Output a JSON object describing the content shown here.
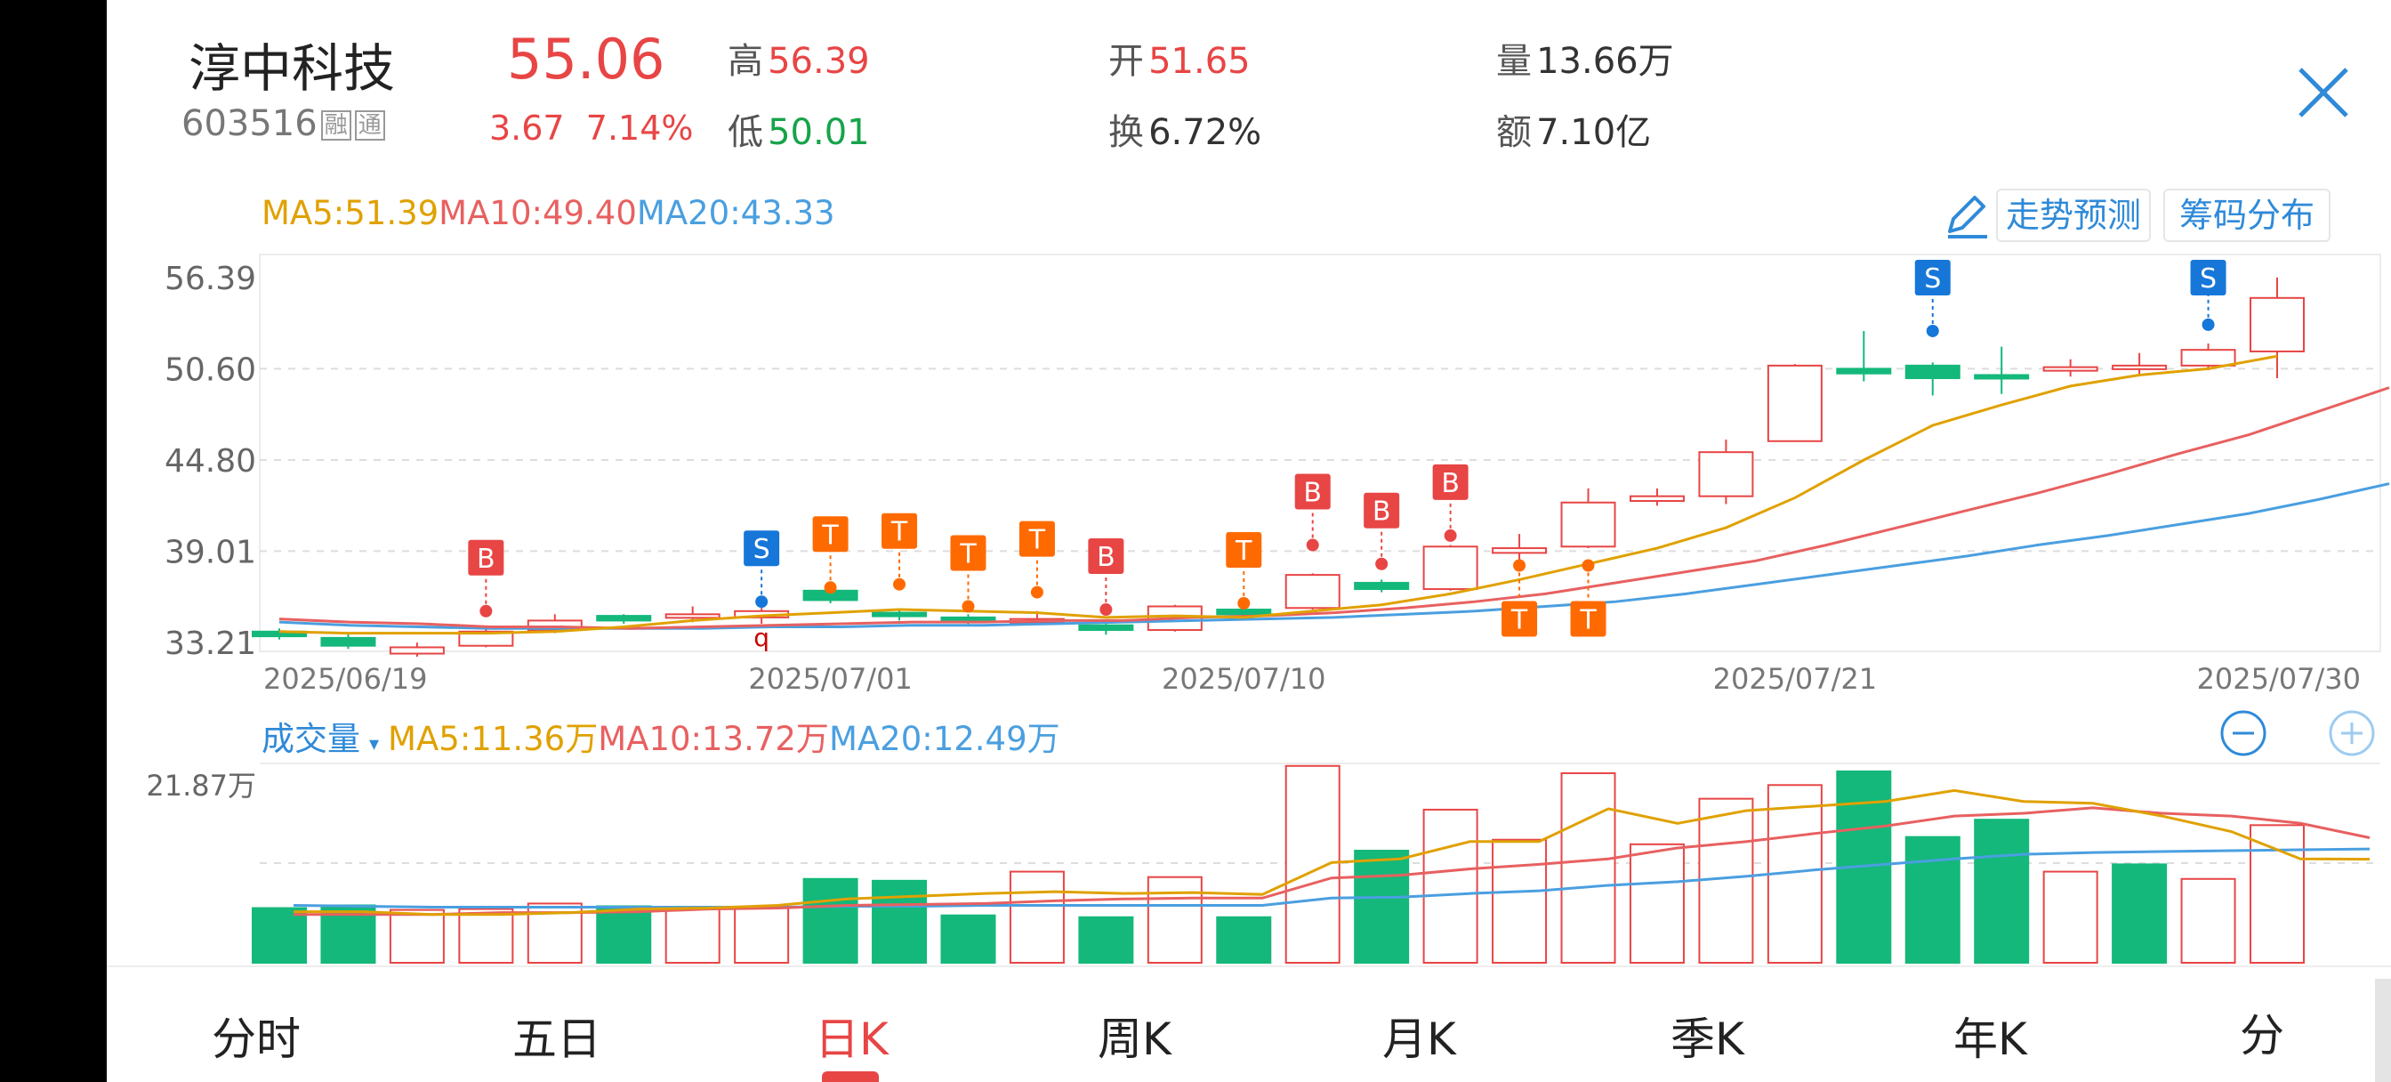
{
  "header": {
    "stock_name": "淳中科技",
    "stock_code": "603516",
    "tags": [
      "融",
      "通"
    ],
    "price": "55.06",
    "change": "3.67",
    "change_pct": "7.14%",
    "high_label": "高",
    "high": "56.39",
    "low_label": "低",
    "low": "50.01",
    "open_label": "开",
    "open": "51.65",
    "turnover_label": "换",
    "turnover": "6.72%",
    "volume_label": "量",
    "volume": "13.66万",
    "amount_label": "额",
    "amount": "7.10亿",
    "close_icon": "close-icon"
  },
  "ma": {
    "ma5": "MA5:51.39",
    "ma10": "MA10:49.40",
    "ma20": "MA20:43.33"
  },
  "buttons": {
    "trend": "走势预测",
    "chips": "筹码分布",
    "edit_icon": "pencil-icon"
  },
  "colors": {
    "up": "#e84545",
    "down": "#14b87a",
    "ma5": "#e0a100",
    "ma10": "#e86060",
    "ma20": "#4a9fe0",
    "accent": "#2f8ad8",
    "signal_t": "#ff6a00",
    "signal_s": "#1677d9"
  },
  "price_axis": {
    "labels": [
      "56.39",
      "50.60",
      "44.80",
      "39.01",
      "33.21"
    ],
    "values": [
      56.39,
      50.6,
      44.8,
      39.01,
      33.21
    ]
  },
  "date_axis": [
    "2025/06/19",
    "2025/07/01",
    "2025/07/10",
    "2025/07/21",
    "2025/07/30"
  ],
  "volume_panel": {
    "title": "成交量",
    "ma5": "MA5:11.36万",
    "ma10": "MA10:13.72万",
    "ma20": "MA20:12.49万",
    "max_label": "21.87万",
    "max_value": 21.87,
    "zoom_out_icon": "minus-circle-icon",
    "zoom_in_icon": "plus-circle-icon"
  },
  "chart_data": {
    "type": "candlestick",
    "ylim": [
      33.21,
      56.39
    ],
    "candles": [
      {
        "o": 33.9,
        "c": 33.6,
        "h": 34.1,
        "l": 33.4
      },
      {
        "o": 33.5,
        "c": 33.0,
        "h": 33.8,
        "l": 32.8
      },
      {
        "o": 32.5,
        "c": 32.9,
        "h": 33.2,
        "l": 32.3
      },
      {
        "o": 33.0,
        "c": 33.9,
        "h": 34.2,
        "l": 32.9
      },
      {
        "o": 34.0,
        "c": 34.6,
        "h": 35.0,
        "l": 33.8
      },
      {
        "o": 34.9,
        "c": 34.6,
        "h": 35.0,
        "l": 34.4
      },
      {
        "o": 34.9,
        "c": 35.0,
        "h": 35.5,
        "l": 34.5
      },
      {
        "o": 34.8,
        "c": 35.2,
        "h": 35.4,
        "l": 34.4
      },
      {
        "o": 36.5,
        "c": 35.9,
        "h": 36.6,
        "l": 35.7
      },
      {
        "o": 35.1,
        "c": 34.9,
        "h": 35.3,
        "l": 34.6
      },
      {
        "o": 34.8,
        "c": 34.5,
        "h": 35.0,
        "l": 34.3
      },
      {
        "o": 34.6,
        "c": 34.7,
        "h": 35.2,
        "l": 34.4
      },
      {
        "o": 34.3,
        "c": 34.0,
        "h": 34.5,
        "l": 33.7
      },
      {
        "o": 34.0,
        "c": 35.5,
        "h": 35.6,
        "l": 33.9
      },
      {
        "o": 35.3,
        "c": 35.0,
        "h": 35.4,
        "l": 34.8
      },
      {
        "o": 35.4,
        "c": 37.5,
        "h": 37.6,
        "l": 35.3
      },
      {
        "o": 37.0,
        "c": 36.6,
        "h": 37.2,
        "l": 36.4
      },
      {
        "o": 36.6,
        "c": 39.3,
        "h": 39.4,
        "l": 36.5
      },
      {
        "o": 38.9,
        "c": 39.2,
        "h": 40.1,
        "l": 38.1
      },
      {
        "o": 39.3,
        "c": 42.1,
        "h": 43.0,
        "l": 39.2
      },
      {
        "o": 42.2,
        "c": 42.5,
        "h": 43.0,
        "l": 41.9
      },
      {
        "o": 42.5,
        "c": 45.3,
        "h": 46.1,
        "l": 42.0
      },
      {
        "o": 46.0,
        "c": 50.8,
        "h": 50.9,
        "l": 46.0
      },
      {
        "o": 50.6,
        "c": 50.3,
        "h": 53.0,
        "l": 49.8
      },
      {
        "o": 50.8,
        "c": 50.0,
        "h": 51.0,
        "l": 48.9
      },
      {
        "o": 50.2,
        "c": 50.1,
        "h": 52.0,
        "l": 49.0
      },
      {
        "o": 50.5,
        "c": 50.7,
        "h": 51.2,
        "l": 50.1
      },
      {
        "o": 50.6,
        "c": 50.8,
        "h": 51.6,
        "l": 50.2
      },
      {
        "o": 50.8,
        "c": 51.8,
        "h": 52.2,
        "l": 50.5
      },
      {
        "o": 51.7,
        "c": 55.1,
        "h": 56.4,
        "l": 50.0
      }
    ],
    "ma5_series": [
      33.9,
      33.8,
      33.8,
      33.8,
      33.9,
      34.2,
      34.6,
      34.9,
      35.1,
      35.3,
      35.2,
      35.1,
      34.8,
      34.9,
      34.8,
      35.2,
      35.6,
      36.3,
      37.2,
      38.2,
      39.2,
      40.5,
      42.4,
      44.8,
      47.0,
      48.3,
      49.5,
      50.2,
      50.6,
      51.4
    ],
    "ma10_series": [
      34.7,
      34.5,
      34.4,
      34.2,
      34.2,
      34.1,
      34.2,
      34.3,
      34.4,
      34.5,
      34.5,
      34.6,
      34.6,
      34.8,
      34.9,
      35.1,
      35.4,
      35.8,
      36.3,
      37.0,
      37.7,
      38.4,
      39.4,
      40.5,
      41.6,
      42.7,
      43.9,
      45.2,
      46.4,
      47.9,
      49.4
    ],
    "ma20_series": [
      34.5,
      34.3,
      34.2,
      34.1,
      34.1,
      34.1,
      34.1,
      34.2,
      34.2,
      34.3,
      34.3,
      34.4,
      34.5,
      34.6,
      34.7,
      34.8,
      35.0,
      35.2,
      35.5,
      35.8,
      36.3,
      36.9,
      37.5,
      38.1,
      38.7,
      39.4,
      40.0,
      40.7,
      41.4,
      42.3,
      43.3
    ],
    "signals": [
      {
        "i": 3,
        "label": "B",
        "type": "buy",
        "pos": "above",
        "price": 35.2
      },
      {
        "i": 7,
        "label": "S",
        "type": "sell",
        "pos": "above",
        "price": 35.8
      },
      {
        "i": 8,
        "label": "T",
        "type": "t",
        "pos": "above",
        "price": 36.7
      },
      {
        "i": 9,
        "label": "T",
        "type": "t",
        "pos": "above",
        "price": 36.9
      },
      {
        "i": 10,
        "label": "T",
        "type": "t",
        "pos": "above",
        "price": 35.5
      },
      {
        "i": 11,
        "label": "T",
        "type": "t",
        "pos": "above",
        "price": 36.4
      },
      {
        "i": 12,
        "label": "B",
        "type": "buy",
        "pos": "above",
        "price": 35.3
      },
      {
        "i": 14,
        "label": "T",
        "type": "t",
        "pos": "above",
        "price": 35.7
      },
      {
        "i": 15,
        "label": "B",
        "type": "buy",
        "pos": "above",
        "price": 39.4
      },
      {
        "i": 16,
        "label": "B",
        "type": "buy",
        "pos": "above",
        "price": 38.2
      },
      {
        "i": 17,
        "label": "B",
        "type": "buy",
        "pos": "above",
        "price": 40.0
      },
      {
        "i": 18,
        "label": "T",
        "type": "t",
        "pos": "below",
        "price": 38.1
      },
      {
        "i": 19,
        "label": "T",
        "type": "t",
        "pos": "below",
        "price": 38.1
      },
      {
        "i": 24,
        "label": "S",
        "type": "sell",
        "pos": "above",
        "price": 53.0
      },
      {
        "i": 28,
        "label": "S",
        "type": "sell",
        "pos": "above",
        "price": 53.4
      }
    ],
    "annotation": {
      "i": 7,
      "text": "q"
    },
    "volume": [
      {
        "v": 6.0,
        "up": false
      },
      {
        "v": 6.3,
        "up": false
      },
      {
        "v": 5.8,
        "up": true
      },
      {
        "v": 5.9,
        "up": true
      },
      {
        "v": 6.5,
        "up": true
      },
      {
        "v": 6.2,
        "up": false
      },
      {
        "v": 6.1,
        "up": true
      },
      {
        "v": 6.0,
        "up": true
      },
      {
        "v": 9.2,
        "up": false
      },
      {
        "v": 9.0,
        "up": false
      },
      {
        "v": 5.2,
        "up": false
      },
      {
        "v": 10.0,
        "up": true
      },
      {
        "v": 5.0,
        "up": false
      },
      {
        "v": 9.4,
        "up": true
      },
      {
        "v": 5.0,
        "up": false
      },
      {
        "v": 21.6,
        "up": true
      },
      {
        "v": 12.3,
        "up": false
      },
      {
        "v": 16.8,
        "up": true
      },
      {
        "v": 13.5,
        "up": true
      },
      {
        "v": 20.8,
        "up": true
      },
      {
        "v": 13.0,
        "up": true
      },
      {
        "v": 18.0,
        "up": true
      },
      {
        "v": 19.5,
        "up": true
      },
      {
        "v": 21.0,
        "up": false
      },
      {
        "v": 13.8,
        "up": false
      },
      {
        "v": 15.7,
        "up": false
      },
      {
        "v": 10.0,
        "up": true
      },
      {
        "v": 10.8,
        "up": false
      },
      {
        "v": 9.2,
        "up": true
      },
      {
        "v": 15.1,
        "up": true
      }
    ],
    "vol_ma5": [
      5.6,
      5.6,
      5.3,
      5.3,
      5.5,
      5.9,
      6.0,
      6.3,
      7.0,
      7.3,
      7.6,
      7.8,
      7.6,
      7.7,
      7.5,
      11.0,
      11.4,
      13.3,
      13.3,
      16.9,
      15.3,
      16.7,
      17.2,
      17.7,
      18.9,
      17.7,
      17.5,
      16.1,
      14.4,
      11.4,
      11.36
    ],
    "vol_ma10": [
      5.3,
      5.3,
      5.3,
      5.5,
      5.5,
      5.6,
      5.9,
      6.0,
      6.3,
      6.4,
      6.5,
      6.8,
      7.0,
      7.1,
      7.1,
      9.3,
      9.6,
      10.3,
      10.8,
      11.4,
      12.6,
      13.3,
      14.2,
      15.0,
      16.1,
      16.4,
      17.0,
      16.4,
      16.1,
      15.3,
      13.72
    ],
    "vol_ma20": [
      6.3,
      6.2,
      6.1,
      6.1,
      6.1,
      6.1,
      6.1,
      6.1,
      6.2,
      6.2,
      6.3,
      6.3,
      6.3,
      6.3,
      6.3,
      7.1,
      7.2,
      7.6,
      7.9,
      8.5,
      8.9,
      9.5,
      10.2,
      10.8,
      11.4,
      11.9,
      12.1,
      12.2,
      12.3,
      12.4,
      12.49
    ]
  },
  "tabs": [
    "分时",
    "五日",
    "日K",
    "周K",
    "月K",
    "季K",
    "年K",
    "分"
  ],
  "active_tab": 2
}
